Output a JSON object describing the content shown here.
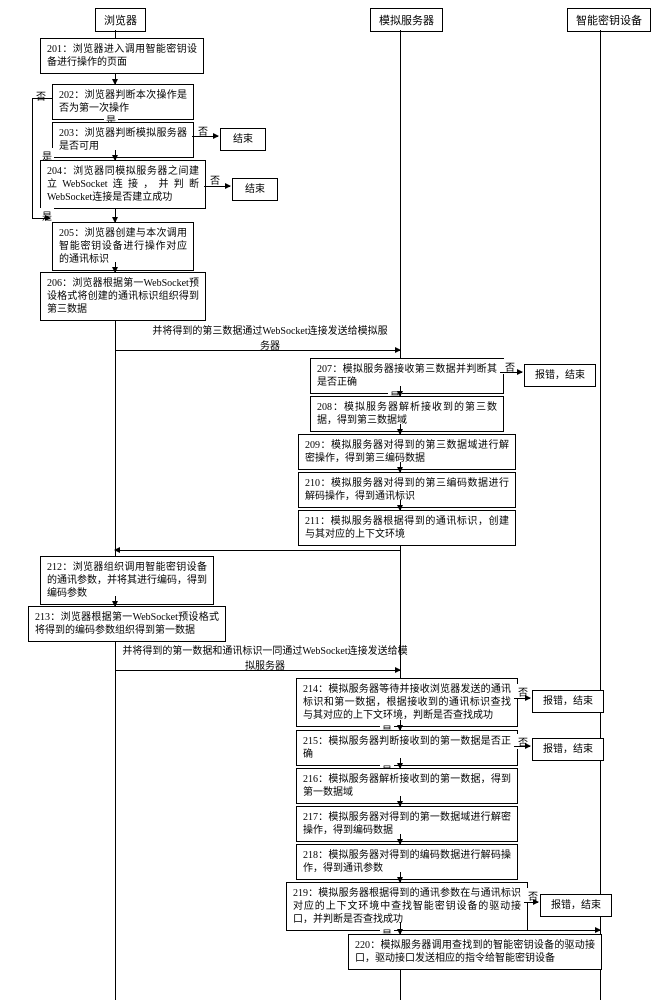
{
  "lanes": {
    "browser": "浏览器",
    "server": "模拟服务器",
    "device": "智能密钥设备"
  },
  "labels": {
    "yes": "是",
    "no": "否"
  },
  "steps": {
    "s201": "201：浏览器进入调用智能密钥设备进行操作的页面",
    "s202": "202：浏览器判断本次操作是否为第一次操作",
    "s203": "203：浏览器判断模拟服务器是否可用",
    "s204": "204：浏览器同模拟服务器之间建立WebSocket连接，并判断WebSocket连接是否建立成功",
    "s205": "205：浏览器创建与本次调用智能密钥设备进行操作对应的通讯标识",
    "s206": "206：浏览器根据第一WebSocket预设格式将创建的通讯标识组织得到第三数据",
    "s207": "207：模拟服务器接收第三数据并判断其是否正确",
    "s208": "208：模拟服务器解析接收到的第三数据，得到第三数据域",
    "s209": "209：模拟服务器对得到的第三数据域进行解密操作，得到第三编码数据",
    "s210": "210：模拟服务器对得到的第三编码数据进行解码操作，得到通讯标识",
    "s211": "211：模拟服务器根据得到的通讯标识，创建与其对应的上下文环境",
    "s212": "212：浏览器组织调用智能密钥设备的通讯参数，并将其进行编码，得到编码参数",
    "s213": "213：浏览器根据第一WebSocket预设格式将得到的编码参数组织得到第一数据",
    "s214": "214：模拟服务器等待并接收浏览器发送的通讯标识和第一数据，根据接收到的通讯标识查找与其对应的上下文环境，判断是否查找成功",
    "s215": "215：模拟服务器判断接收到的第一数据是否正确",
    "s216": "216：模拟服务器解析接收到的第一数据，得到第一数据域",
    "s217": "217：模拟服务器对得到的第一数据域进行解密操作，得到编码数据",
    "s218": "218：模拟服务器对得到的编码数据进行解码操作，得到通讯参数",
    "s219": "219：模拟服务器根据得到的通讯参数在与通讯标识对应的上下文环境中查找智能密钥设备的驱动接口，并判断是否查找成功",
    "s220": "220：模拟服务器调用查找到的智能密钥设备的驱动接口，驱动接口发送相应的指令给智能密钥设备",
    "end": "结束",
    "err_end": "报错，结束"
  },
  "messages": {
    "m1": "并将得到的第三数据通过WebSocket连接发送给模拟服务器",
    "m2": "并将得到的第一数据和通讯标识一同通过WebSocket连接发送给模拟服务器"
  }
}
